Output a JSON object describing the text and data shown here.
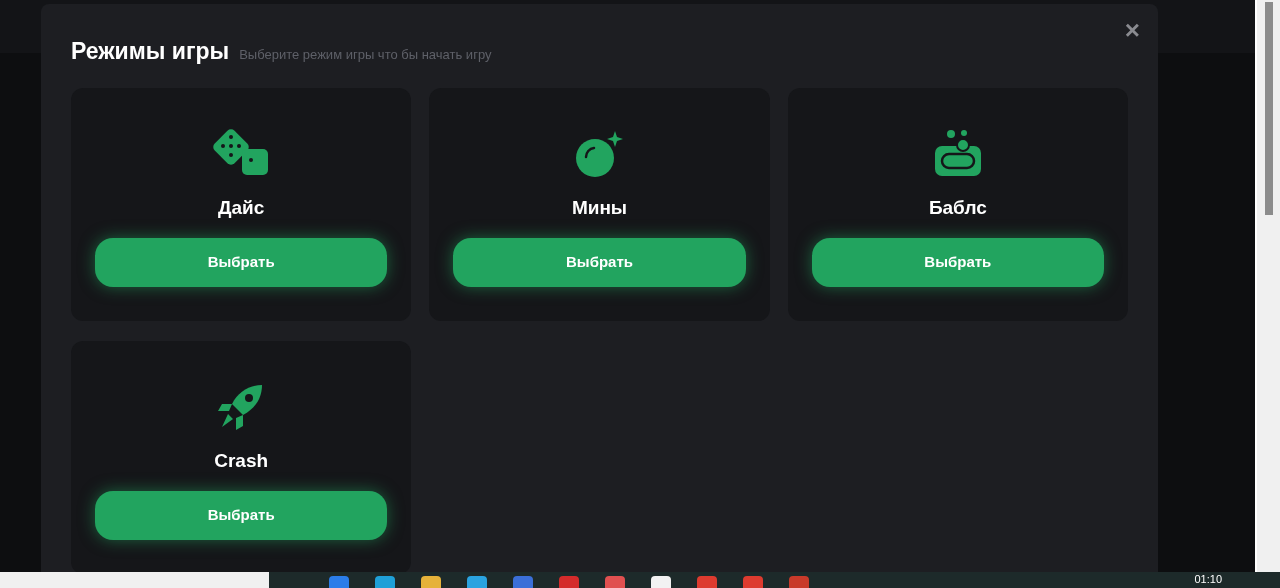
{
  "modal": {
    "title": "Режимы игры",
    "subtitle": "Выберите режим игры что бы начать игру",
    "close": "×",
    "modes": [
      {
        "kind": "dice",
        "name": "Дайс",
        "button": "Выбрать"
      },
      {
        "kind": "bomb",
        "name": "Мины",
        "button": "Выбрать"
      },
      {
        "kind": "bubbles",
        "name": "Баблс",
        "button": "Выбрать"
      },
      {
        "kind": "rocket",
        "name": "Crash",
        "button": "Выбрать"
      }
    ]
  },
  "taskbar": {
    "time": "01:10"
  }
}
